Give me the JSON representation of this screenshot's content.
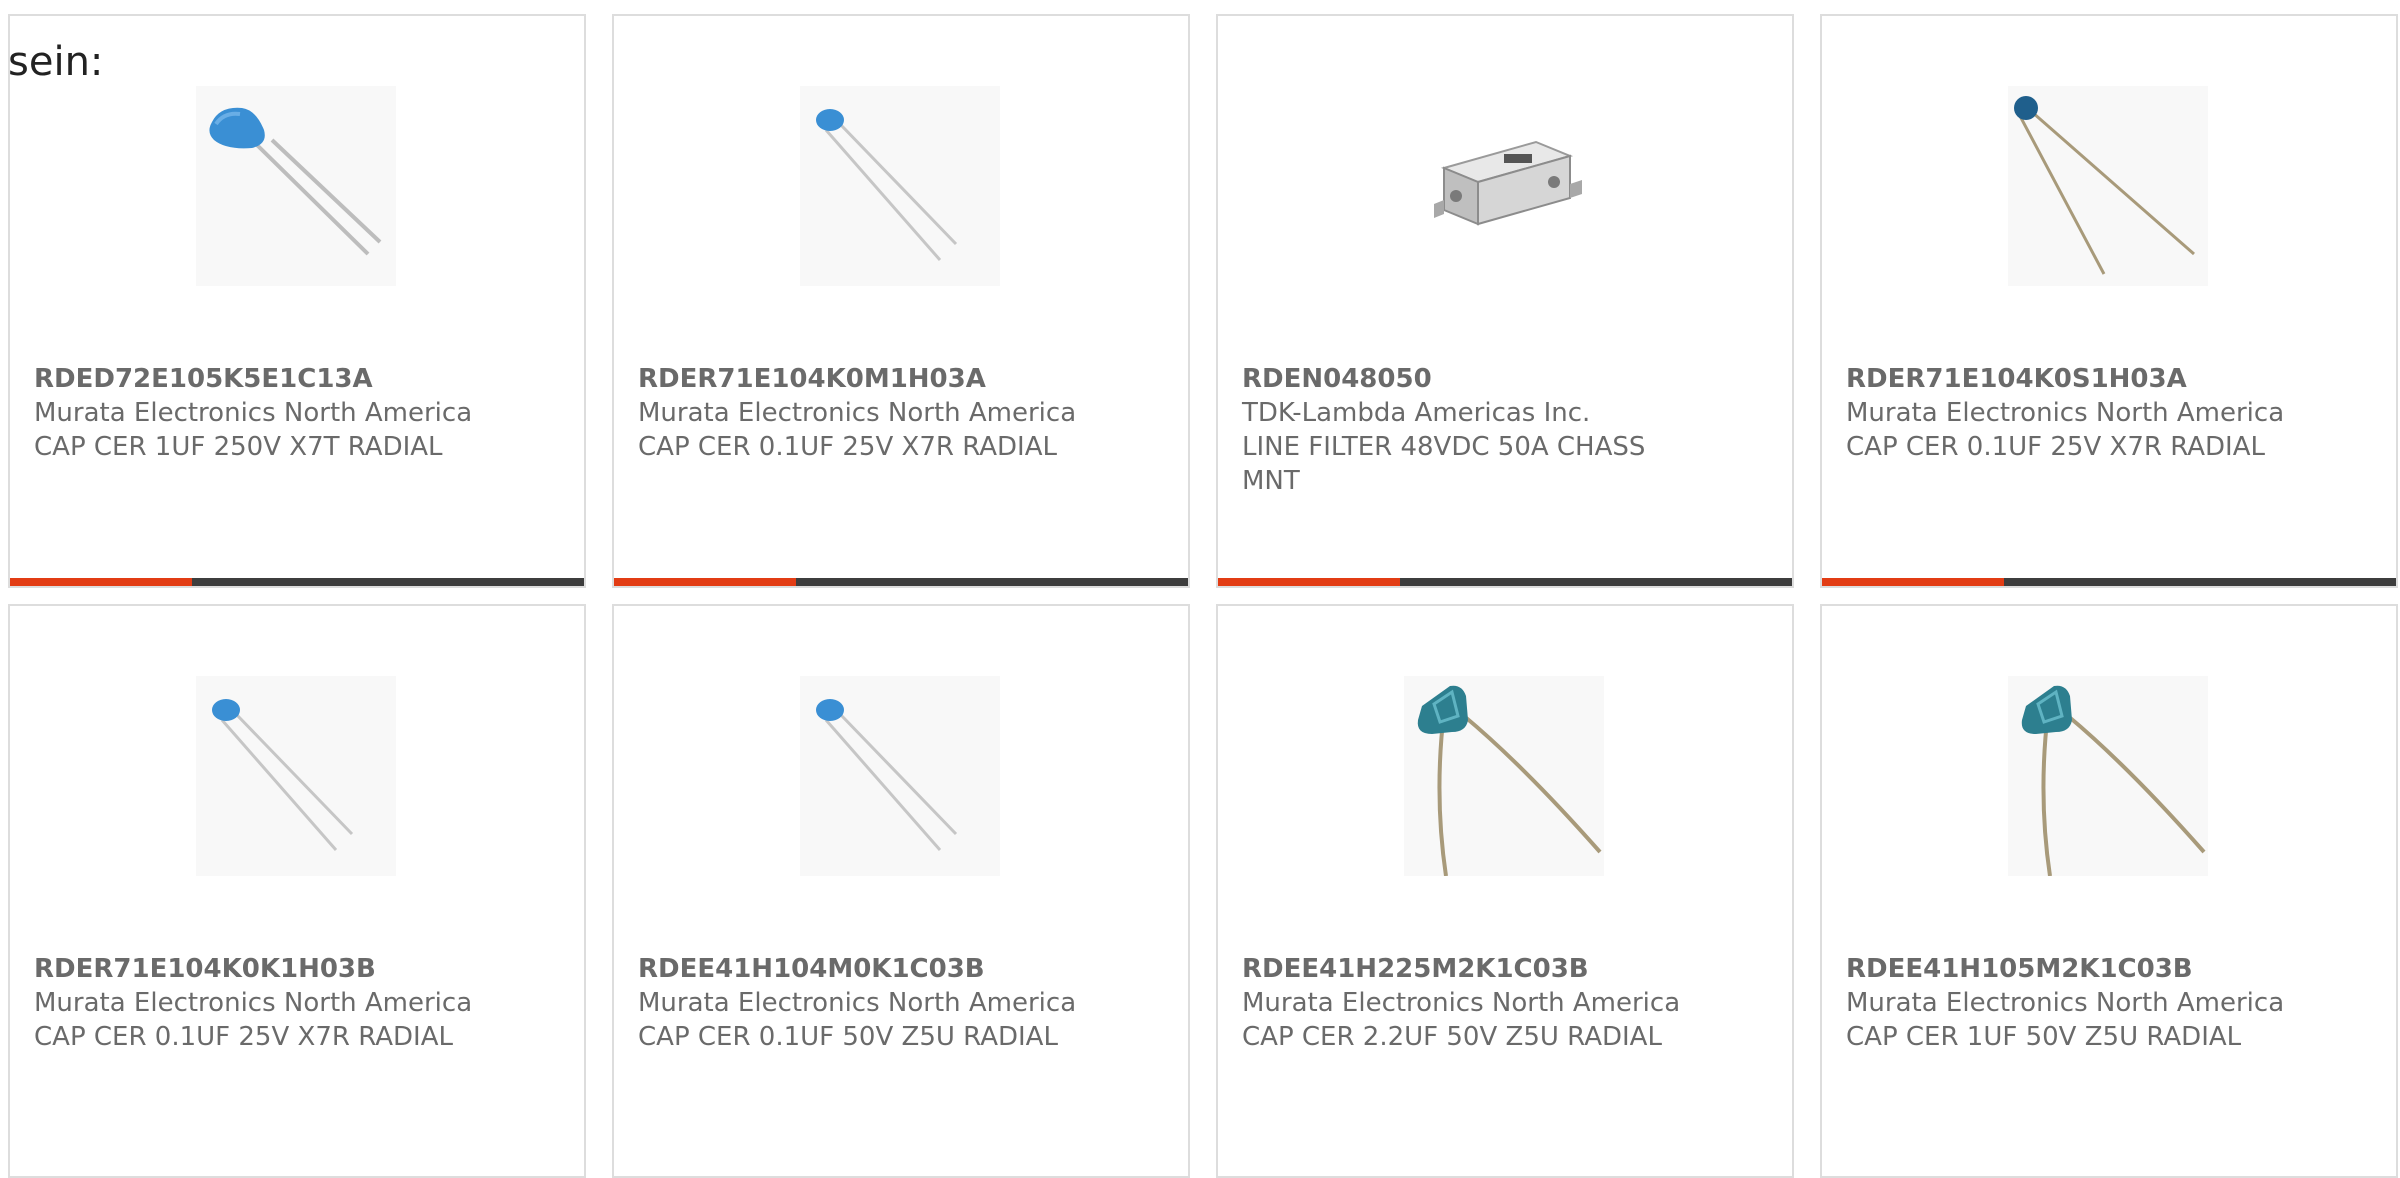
{
  "intro_text": "sein:",
  "products": [
    {
      "part_number": "RDED72E105K5E1C13A",
      "manufacturer": "Murata Electronics North America",
      "description": "CAP CER 1UF 250V X7T RADIAL",
      "image": "ceramic-capacitor-blue-icon"
    },
    {
      "part_number": "RDER71E104K0M1H03A",
      "manufacturer": "Murata Electronics North America",
      "description": "CAP CER 0.1UF 25V X7R RADIAL",
      "image": "ceramic-capacitor-blue-small-icon"
    },
    {
      "part_number": "RDEN048050",
      "manufacturer": "TDK-Lambda Americas Inc.",
      "description": "LINE FILTER 48VDC 50A CHASS MNT",
      "image": "line-filter-module-icon"
    },
    {
      "part_number": "RDER71E104K0S1H03A",
      "manufacturer": "Murata Electronics North America",
      "description": "CAP CER 0.1UF 25V X7R RADIAL",
      "image": "ceramic-capacitor-dark-blue-icon"
    },
    {
      "part_number": "RDER71E104K0K1H03B",
      "manufacturer": "Murata Electronics North America",
      "description": "CAP CER 0.1UF 25V X7R RADIAL",
      "image": "ceramic-capacitor-blue-small-icon"
    },
    {
      "part_number": "RDEE41H104M0K1C03B",
      "manufacturer": "Murata Electronics North America",
      "description": "CAP CER 0.1UF 50V Z5U RADIAL",
      "image": "ceramic-capacitor-blue-small-icon"
    },
    {
      "part_number": "RDEE41H225M2K1C03B",
      "manufacturer": "Murata Electronics North America",
      "description": "CAP CER 2.2UF 50V Z5U RADIAL",
      "image": "ceramic-capacitor-teal-icon"
    },
    {
      "part_number": "RDEE41H105M2K1C03B",
      "manufacturer": "Murata Electronics North America",
      "description": "CAP CER 1UF 50V Z5U RADIAL",
      "image": "ceramic-capacitor-teal-icon"
    }
  ],
  "colors": {
    "accent": "#e23c14",
    "bar_dark": "#3d3d3d",
    "text": "#6a6a6a",
    "border": "#dddddd",
    "capacitor_blue": "#3a8fd4",
    "capacitor_dark_blue": "#1f5f8c",
    "capacitor_teal": "#2d7f8f"
  }
}
